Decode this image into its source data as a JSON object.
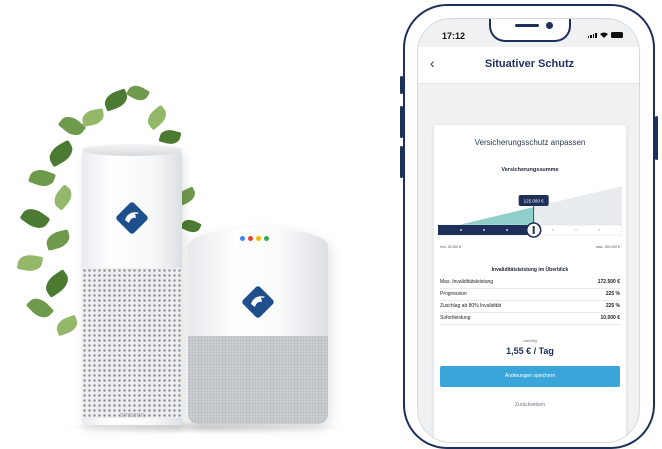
{
  "scene": {
    "echo_brand": "amazon",
    "badge_icon": "eagle-shield-icon",
    "badge_color": "#1f4e8c",
    "led_colors": [
      "#4285f4",
      "#ea4335",
      "#fbbc05",
      "#34a853"
    ]
  },
  "phone": {
    "status_time": "17:12",
    "appbar": {
      "back_icon": "chevron-left-icon",
      "back_glyph": "‹",
      "title": "Situativer Schutz"
    },
    "card": {
      "title": "Versicherungsschutz anpassen",
      "slider_label": "Versicherungssumme",
      "slider_value": "125.000 €",
      "slider_fraction": 0.52,
      "range_min": "min. 25.000 €",
      "range_max": "max. 150.000 €",
      "section_title": "Invaliditätsleistung im Überblick",
      "rows": [
        {
          "label": "Max. Invaliditätsleistung",
          "value": "172.500 €"
        },
        {
          "label": "Progression",
          "value": "225 %"
        },
        {
          "label": "Zuschlag ab 80% Invalidität",
          "value": "225 %"
        },
        {
          "label": "Sofortleistung",
          "value": "10.000 €"
        }
      ],
      "price_label": "zukünftig",
      "price": "1,55 € / Tag",
      "save_label": "Änderungen speichern",
      "reset_label": "Zurücksetzen"
    }
  },
  "colors": {
    "accent": "#3aa5d8",
    "navy": "#1e2f5a",
    "teal": "#8fcfca"
  }
}
